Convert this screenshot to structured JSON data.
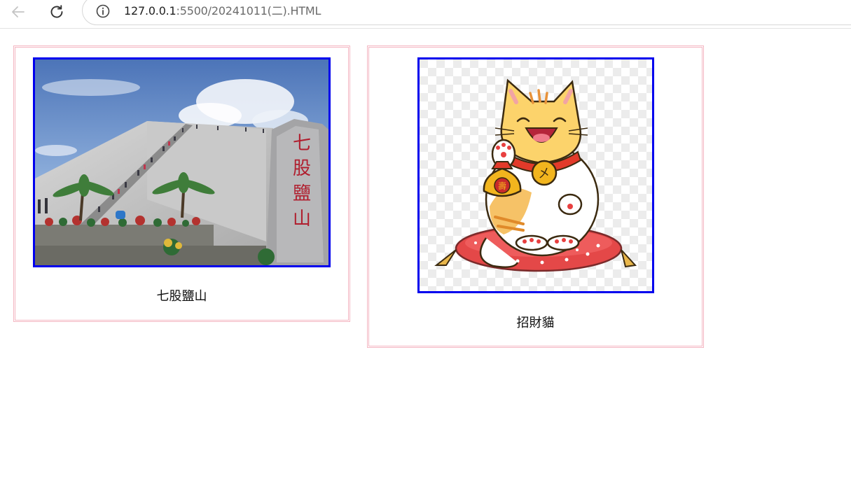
{
  "browser": {
    "address_host": "127.0.0.1",
    "address_path": ":5500/20241011(二).HTML",
    "back_icon": "arrow-left-icon",
    "reload_icon": "reload-icon",
    "site_info_icon": "info-icon"
  },
  "gallery": [
    {
      "caption": "七股鹽山",
      "sign_text": "七股鹽山",
      "image": "salt-mountain-photo"
    },
    {
      "caption": "招財貓",
      "bell_mark": "㐅",
      "coin_mark": "壽",
      "image": "lucky-cat-illustration"
    }
  ],
  "colors": {
    "card_border": "#f4b6c2",
    "image_border": "#0000ee"
  }
}
